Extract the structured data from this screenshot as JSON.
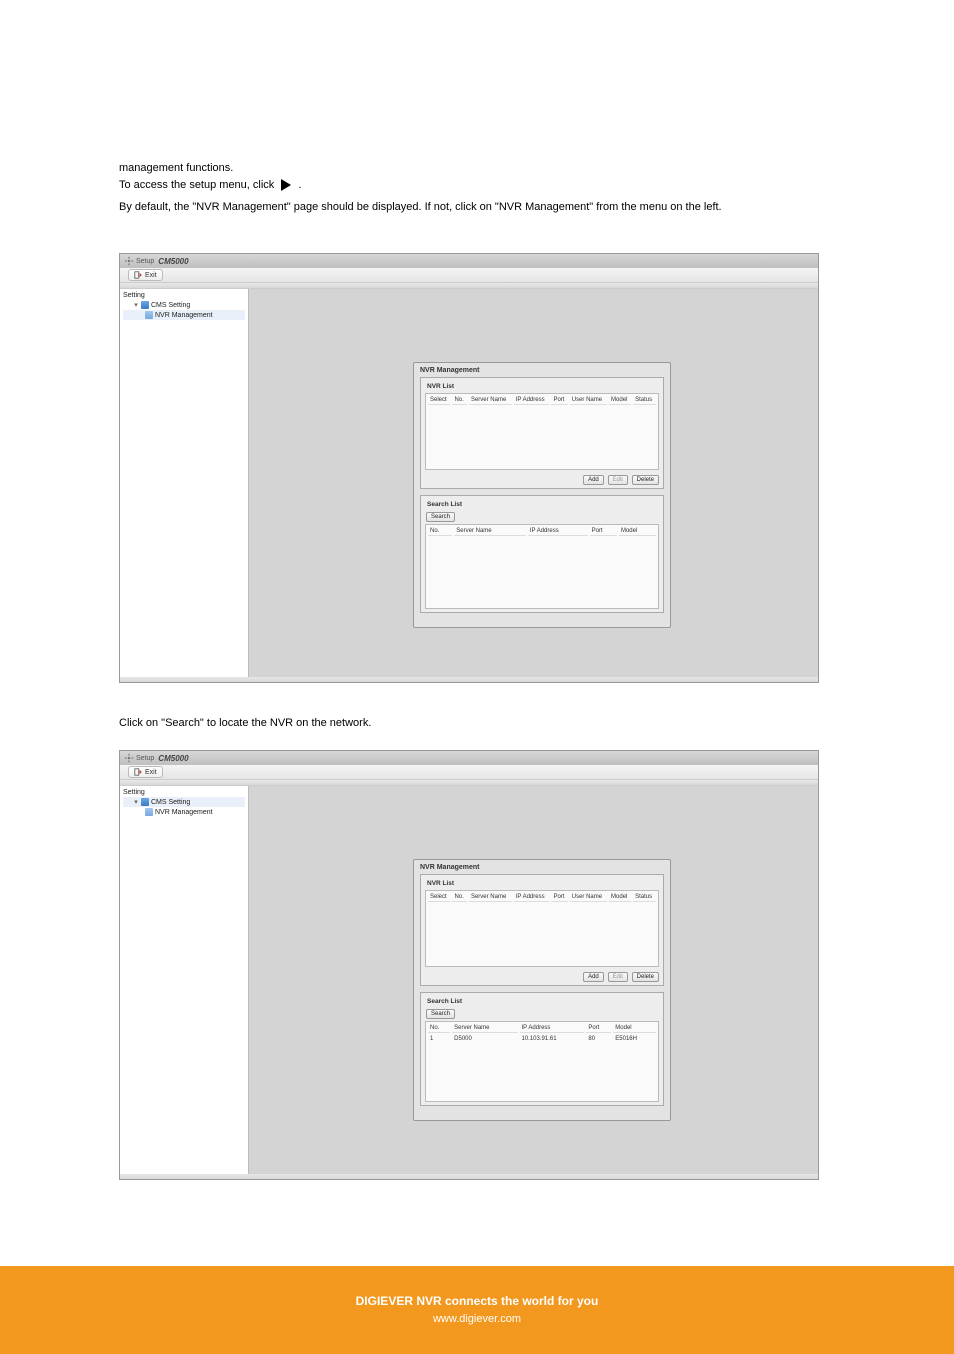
{
  "doc": {
    "para1": "management functions.",
    "line2_a": "To access the setup menu, click",
    "line2_b": ".",
    "para2": "By default, the \"NVR Management\" page should be displayed. If not, click on \"NVR Management\" from the menu on the left.",
    "para3": "Click on \"Search\" to locate the NVR on the network."
  },
  "app": {
    "titlebar_label": "Setup",
    "app_name": "CM5000",
    "exit_label": "Exit",
    "tree": {
      "root": "Setting",
      "parent": "CMS Setting",
      "leaf": "NVR Management"
    },
    "mgmt": {
      "title": "NVR Management",
      "nvr_list": {
        "legend": "NVR List",
        "headers": [
          "Select",
          "No.",
          "Server Name",
          "IP Address",
          "Port",
          "User Name",
          "Model",
          "Status"
        ]
      },
      "buttons": {
        "add": "Add",
        "edit": "Edit",
        "delete": "Delete"
      },
      "search_list": {
        "legend": "Search List",
        "search_btn": "Search",
        "headers": [
          "No.",
          "Server Name",
          "IP Address",
          "Port",
          "Model"
        ]
      }
    },
    "search_result": {
      "no": "1",
      "server_name": "D5000",
      "ip": "10.103.91.61",
      "port": "80",
      "model": "E5016H"
    }
  },
  "footer": {
    "line1": "DIGIEVER NVR connects the world for you",
    "line2": "www.digiever.com"
  }
}
